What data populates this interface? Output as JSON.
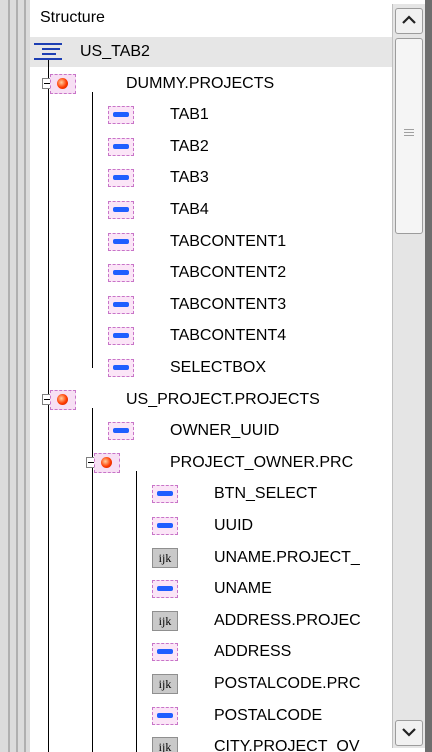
{
  "panel": {
    "header_label": "Structure",
    "root": {
      "label": "US_TAB2",
      "icon": "structure-icon"
    },
    "rows": [
      {
        "label": "DUMMY.PROJECTS",
        "icon": "table-icon",
        "level": 1,
        "expander": "collapse"
      },
      {
        "label": "TAB1",
        "icon": "field-icon",
        "level": 2
      },
      {
        "label": "TAB2",
        "icon": "field-icon",
        "level": 2
      },
      {
        "label": "TAB3",
        "icon": "field-icon",
        "level": 2
      },
      {
        "label": "TAB4",
        "icon": "field-icon",
        "level": 2
      },
      {
        "label": "TABCONTENT1",
        "icon": "field-icon",
        "level": 2
      },
      {
        "label": "TABCONTENT2",
        "icon": "field-icon",
        "level": 2
      },
      {
        "label": "TABCONTENT3",
        "icon": "field-icon",
        "level": 2
      },
      {
        "label": "TABCONTENT4",
        "icon": "field-icon",
        "level": 2
      },
      {
        "label": "SELECTBOX",
        "icon": "field-icon",
        "level": 2
      },
      {
        "label": "US_PROJECT.PROJECTS",
        "icon": "table-icon",
        "level": 1,
        "expander": "collapse"
      },
      {
        "label": "OWNER_UUID",
        "icon": "field-icon",
        "level": 2
      },
      {
        "label": "PROJECT_OWNER.PRC",
        "icon": "table-icon",
        "level": 2,
        "expander": "collapse"
      },
      {
        "label": "BTN_SELECT",
        "icon": "field-icon",
        "level": 3
      },
      {
        "label": "UUID",
        "icon": "field-icon",
        "level": 3
      },
      {
        "label": "UNAME.PROJECT_",
        "icon": "text-icon",
        "level": 3
      },
      {
        "label": "UNAME",
        "icon": "field-icon",
        "level": 3
      },
      {
        "label": "ADDRESS.PROJEC",
        "icon": "text-icon",
        "level": 3
      },
      {
        "label": "ADDRESS",
        "icon": "field-icon",
        "level": 3
      },
      {
        "label": "POSTALCODE.PRC",
        "icon": "text-icon",
        "level": 3
      },
      {
        "label": "POSTALCODE",
        "icon": "field-icon",
        "level": 3
      },
      {
        "label": "CITY.PROJECT_OV",
        "icon": "text-icon",
        "level": 3
      }
    ],
    "text_icon_glyph": "ijk"
  },
  "scrollbar": {
    "up_icon": "chevron-up-icon",
    "down_icon": "chevron-down-icon",
    "grip_icon": "grip-icon"
  }
}
